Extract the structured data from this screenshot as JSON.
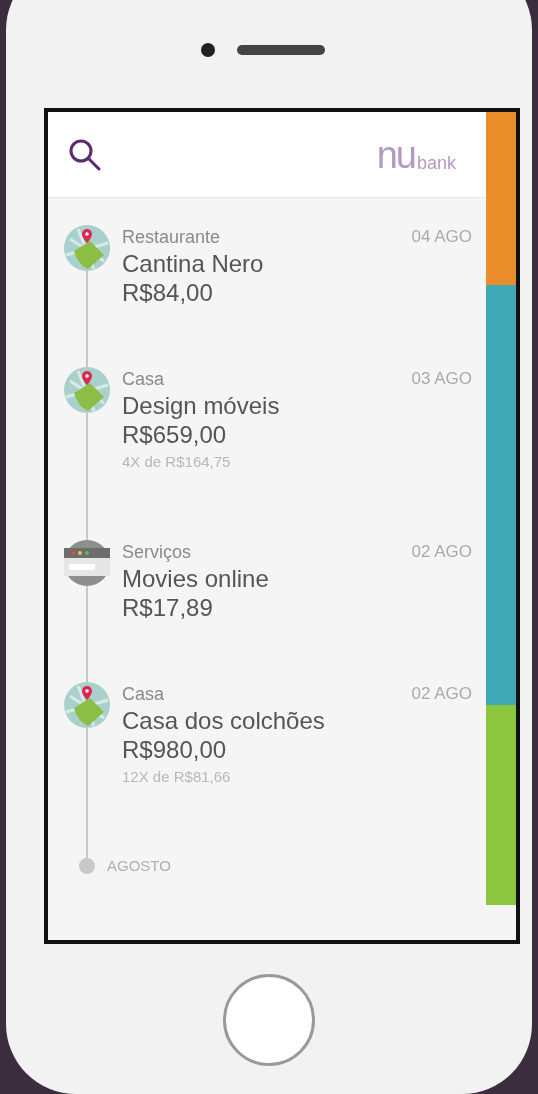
{
  "header": {
    "logo_mark": "nu",
    "logo_word": "bank"
  },
  "transactions": [
    {
      "kind": "map",
      "category": "Restaurante",
      "title": "Cantina Nero",
      "amount": "R$84,00",
      "date": "04 AGO"
    },
    {
      "kind": "map",
      "category": "Casa",
      "title": "Design móveis",
      "amount": "R$659,00",
      "installments": "4X de R$164,75",
      "date": "03 AGO"
    },
    {
      "kind": "web",
      "category": "Serviços",
      "title": "Movies online",
      "amount": "R$17,89",
      "date": "02 AGO"
    },
    {
      "kind": "map",
      "category": "Casa",
      "title": "Casa dos colchões",
      "amount": "R$980,00",
      "installments": "12X de R$81,66",
      "date": "02 AGO"
    }
  ],
  "month_marker": "AGOSTO",
  "color_bar": [
    {
      "color": "#ea8e2c"
    },
    {
      "color": "#3fa9b5"
    },
    {
      "color": "#8cc63f"
    }
  ]
}
